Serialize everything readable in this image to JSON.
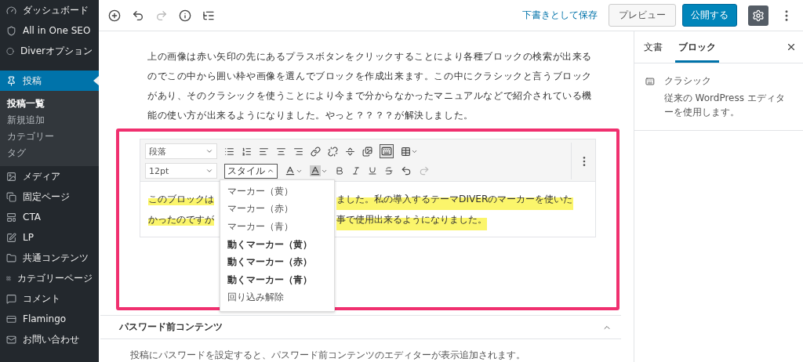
{
  "sidebar": {
    "items": [
      {
        "label": "ダッシュボード",
        "selected": false
      },
      {
        "label": "All in One SEO",
        "selected": false
      },
      {
        "label": "Diverオプション",
        "selected": false
      },
      {
        "label": "投稿",
        "selected": true,
        "children": [
          {
            "label": "投稿一覧",
            "selected": true
          },
          {
            "label": "新規追加",
            "selected": false
          },
          {
            "label": "カテゴリー",
            "selected": false
          },
          {
            "label": "タグ",
            "selected": false
          }
        ]
      },
      {
        "label": "メディア",
        "selected": false
      },
      {
        "label": "固定ページ",
        "selected": false
      },
      {
        "label": "CTA",
        "selected": false
      },
      {
        "label": "LP",
        "selected": false
      },
      {
        "label": "共通コンテンツ",
        "selected": false
      },
      {
        "label": "カテゴリーページ",
        "selected": false
      },
      {
        "label": "コメント",
        "selected": false
      },
      {
        "label": "Flamingo",
        "selected": false
      },
      {
        "label": "お問い合わせ",
        "selected": false
      }
    ]
  },
  "top_toolbar": {
    "redo_enabled": false,
    "save_draft": "下書きとして保存",
    "preview": "プレビュー",
    "publish": "公開する",
    "settings_open": true
  },
  "intro_paragraph": "上の画像は赤い矢印の先にあるプラスボタンをクリックすることにより各種ブロックの検索が出来るのでこの中から囲い枠や画像を選んでブロックを作成出来ます。この中にクラシックと言うブロックがあり、そのクラシックを使うことにより今まで分からなかったマニュアルなどで紹介されている機能の使い方が出来るようになりました。やっと？？？？が解決しました。",
  "classic_block": {
    "format_select": "段落",
    "size_select": "12pt",
    "style_button": {
      "label": "スタイル",
      "expanded": true
    },
    "keyboard_toggle_pressed": true,
    "redo_enabled": false,
    "style_menu": [
      {
        "label": "マーカー（黄）",
        "bold": false
      },
      {
        "label": "マーカー（赤）",
        "bold": false
      },
      {
        "label": "マーカー（青）",
        "bold": false
      },
      {
        "label": "動くマーカー（黄）",
        "bold": true
      },
      {
        "label": "動くマーカー（赤）",
        "bold": true
      },
      {
        "label": "動くマーカー（青）",
        "bold": true
      },
      {
        "label": "回り込み解除",
        "bold": false
      }
    ],
    "text_lines": [
      {
        "before": "このブロックは",
        "after": "ました。私の導入するテーマDIVERのマーカーを使いた"
      },
      {
        "before": "かったのですが",
        "after": "事で使用出来るようになりました。"
      }
    ]
  },
  "password_section": {
    "title": "パスワード前コンテンツ",
    "expanded": true,
    "text": "投稿にパスワードを設定すると、パスワード前コンテンツのエディターが表示追加されます。"
  },
  "settings_panel": {
    "tabs": [
      {
        "label": "文書",
        "selected": false
      },
      {
        "label": "ブロック",
        "selected": true
      }
    ],
    "block_name": "クラシック",
    "block_description": "従来の WordPress エディターを使用します。"
  }
}
